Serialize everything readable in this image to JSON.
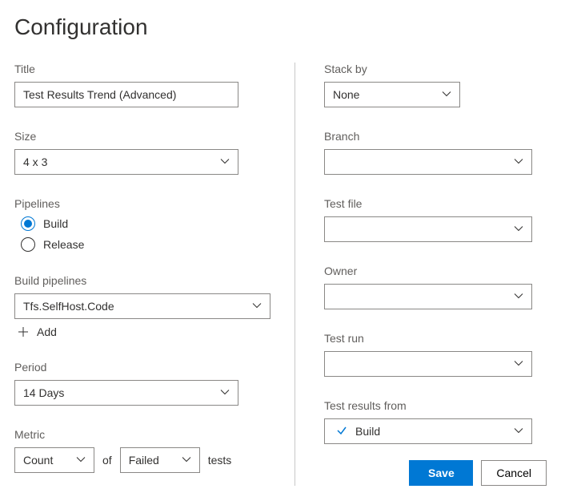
{
  "page": {
    "title": "Configuration"
  },
  "left": {
    "title": {
      "label": "Title",
      "value": "Test Results Trend (Advanced)"
    },
    "size": {
      "label": "Size",
      "value": "4 x 3"
    },
    "pipelines": {
      "label": "Pipelines",
      "options": [
        {
          "label": "Build",
          "selected": true
        },
        {
          "label": "Release",
          "selected": false
        }
      ]
    },
    "buildPipelines": {
      "label": "Build pipelines",
      "value": "Tfs.SelfHost.Code",
      "addLabel": "Add"
    },
    "period": {
      "label": "Period",
      "value": "14 Days"
    },
    "metric": {
      "label": "Metric",
      "count": "Count",
      "of": "of",
      "failed": "Failed",
      "tests": "tests"
    }
  },
  "right": {
    "stackBy": {
      "label": "Stack by",
      "value": "None"
    },
    "branch": {
      "label": "Branch",
      "value": ""
    },
    "testFile": {
      "label": "Test file",
      "value": ""
    },
    "owner": {
      "label": "Owner",
      "value": ""
    },
    "testRun": {
      "label": "Test run",
      "value": ""
    },
    "resultsFrom": {
      "label": "Test results from",
      "value": "Build"
    }
  },
  "footer": {
    "save": "Save",
    "cancel": "Cancel"
  }
}
